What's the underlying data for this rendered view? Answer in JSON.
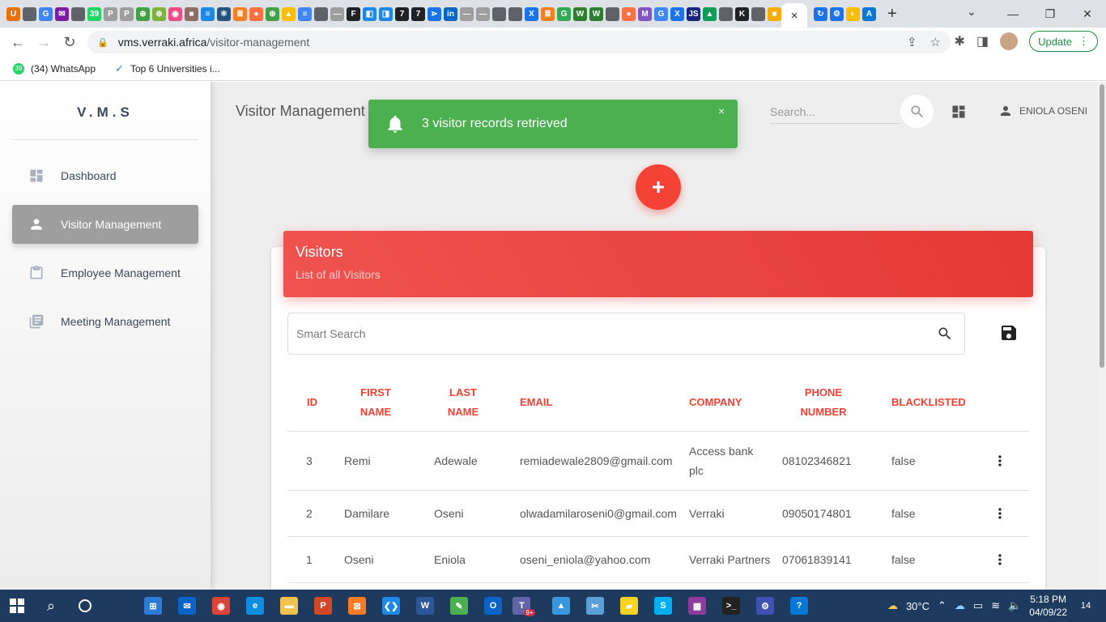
{
  "browser": {
    "active_tab_close": "×",
    "url_host": "vms.verraki.africa",
    "url_path": "/visitor-management",
    "update_label": "Update",
    "bookmarks": [
      {
        "label": "(34) WhatsApp",
        "badge": "39"
      },
      {
        "label": "Top 6 Universities i..."
      }
    ],
    "tab_favicons": [
      {
        "icon": "ublock-icon",
        "color": "#e8710a",
        "glyph": "U"
      },
      {
        "icon": "globe-icon",
        "color": "#5f6368",
        "glyph": ""
      },
      {
        "icon": "google-icon",
        "color": "#4285f4",
        "glyph": "G"
      },
      {
        "icon": "mail-icon",
        "color": "#7b1fa2",
        "glyph": "✉"
      },
      {
        "icon": "globe-icon",
        "color": "#5f6368",
        "glyph": ""
      },
      {
        "icon": "whatsapp-icon",
        "color": "#25d366",
        "glyph": "39"
      },
      {
        "icon": "p-icon",
        "color": "#9e9e9e",
        "glyph": "P"
      },
      {
        "icon": "p-icon",
        "color": "#9e9e9e",
        "glyph": "P"
      },
      {
        "icon": "eth-icon",
        "color": "#43a047",
        "glyph": "⊕"
      },
      {
        "icon": "eth-icon",
        "color": "#7cb342",
        "glyph": "⊕"
      },
      {
        "icon": "dribbble-icon",
        "color": "#ea4c89",
        "glyph": "◉"
      },
      {
        "icon": "square-icon",
        "color": "#8d6e63",
        "glyph": "■"
      },
      {
        "icon": "docs-icon",
        "color": "#1e88e5",
        "glyph": "≡"
      },
      {
        "icon": "react-icon",
        "color": "#26547c",
        "glyph": "⚛"
      },
      {
        "icon": "stack-icon",
        "color": "#f48024",
        "glyph": "≣"
      },
      {
        "icon": "fox-icon",
        "color": "#ff7043",
        "glyph": "●"
      },
      {
        "icon": "eth-icon",
        "color": "#43a047",
        "glyph": "⊕"
      },
      {
        "icon": "drive-icon",
        "color": "#fbbc04",
        "glyph": "▲"
      },
      {
        "icon": "docs-icon",
        "color": "#4285f4",
        "glyph": "≡"
      },
      {
        "icon": "globe-icon",
        "color": "#5f6368",
        "glyph": ""
      },
      {
        "icon": "line-icon",
        "color": "#9e9e9e",
        "glyph": "—"
      },
      {
        "icon": "f-icon",
        "color": "#202124",
        "glyph": "F"
      },
      {
        "icon": "chat-icon",
        "color": "#1e88e5",
        "glyph": "◧"
      },
      {
        "icon": "chat-icon",
        "color": "#1e88e5",
        "glyph": "◨"
      },
      {
        "icon": "seven-icon",
        "color": "#202124",
        "glyph": "7"
      },
      {
        "icon": "seven-icon",
        "color": "#202124",
        "glyph": "7"
      },
      {
        "icon": "share-icon",
        "color": "#1a73e8",
        "glyph": "⋗"
      },
      {
        "icon": "linkedin-icon",
        "color": "#0a66c2",
        "glyph": "in"
      },
      {
        "icon": "line-icon",
        "color": "#9e9e9e",
        "glyph": "—"
      },
      {
        "icon": "line-icon",
        "color": "#9e9e9e",
        "glyph": "—"
      },
      {
        "icon": "globe-icon",
        "color": "#5f6368",
        "glyph": ""
      },
      {
        "icon": "globe-icon",
        "color": "#5f6368",
        "glyph": ""
      },
      {
        "icon": "x-icon",
        "color": "#1a73e8",
        "glyph": "X"
      },
      {
        "icon": "stack-icon",
        "color": "#f48024",
        "glyph": "≣"
      },
      {
        "icon": "google-icon",
        "color": "#34a853",
        "glyph": "G"
      },
      {
        "icon": "w-icon",
        "color": "#2e7d32",
        "glyph": "W"
      },
      {
        "icon": "w-icon",
        "color": "#2e7d32",
        "glyph": "W"
      },
      {
        "icon": "globe-icon",
        "color": "#5f6368",
        "glyph": ""
      },
      {
        "icon": "fox-icon",
        "color": "#ff7043",
        "glyph": "●"
      },
      {
        "icon": "m-icon",
        "color": "#7e57c2",
        "glyph": "M"
      },
      {
        "icon": "google-icon",
        "color": "#4285f4",
        "glyph": "G"
      },
      {
        "icon": "x-icon",
        "color": "#1a73e8",
        "glyph": "X"
      },
      {
        "icon": "js-icon",
        "color": "#1a237e",
        "glyph": "JS"
      },
      {
        "icon": "drive-icon",
        "color": "#0f9d58",
        "glyph": "▲"
      },
      {
        "icon": "globe-icon",
        "color": "#5f6368",
        "glyph": ""
      },
      {
        "icon": "k-icon",
        "color": "#202124",
        "glyph": "K"
      },
      {
        "icon": "globe-icon",
        "color": "#5f6368",
        "glyph": ""
      },
      {
        "icon": "box-icon",
        "color": "#f9ab00",
        "glyph": "■"
      }
    ],
    "tab_favicons_after": [
      {
        "icon": "sync-icon",
        "color": "#1a73e8",
        "glyph": "↻"
      },
      {
        "icon": "gear-icon",
        "color": "#1a73e8",
        "glyph": "⚙"
      },
      {
        "icon": "circle-icon",
        "color": "#fbbc04",
        "glyph": "◐"
      },
      {
        "icon": "azure-icon",
        "color": "#0078d4",
        "glyph": "A"
      }
    ]
  },
  "app": {
    "logo": "V.M.S",
    "sidebar": {
      "items": [
        {
          "label": "Dashboard",
          "icon": "dashboard-icon",
          "active": false
        },
        {
          "label": "Visitor Management",
          "icon": "person-icon",
          "active": true
        },
        {
          "label": "Employee Management",
          "icon": "clipboard-icon",
          "active": false
        },
        {
          "label": "Meeting Management",
          "icon": "library-books-icon",
          "active": false
        }
      ]
    },
    "header": {
      "title": "Visitor Management",
      "search_placeholder": "Search...",
      "user_name": "ENIOLA OSENI"
    },
    "toast": {
      "message": "3 visitor records retrieved",
      "close": "×",
      "color": "#4caf50"
    },
    "fab_label": "+",
    "card": {
      "title": "Visitors",
      "subtitle": "List of all Visitors",
      "search_placeholder": "Smart Search",
      "accent": "#f44336",
      "columns": [
        "ID",
        "FIRST NAME",
        "LAST NAME",
        "EMAIL",
        "COMPANY",
        "PHONE NUMBER",
        "BLACKLISTED"
      ],
      "rows": [
        {
          "id": "3",
          "first": "Remi",
          "last": "Adewale",
          "email": "remiadewale2809@gmail.com",
          "company": "Access bank plc",
          "phone": "08102346821",
          "blacklisted": "false"
        },
        {
          "id": "2",
          "first": "Damilare",
          "last": "Oseni",
          "email": "olwadamilaroseni0@gmail.com",
          "company": "Verraki",
          "phone": "09050174801",
          "blacklisted": "false"
        },
        {
          "id": "1",
          "first": "Oseni",
          "last": "Eniola",
          "email": "oseni_eniola@yahoo.com",
          "company": "Verraki Partners",
          "phone": "07061839141",
          "blacklisted": "false"
        }
      ]
    }
  },
  "taskbar": {
    "apps": [
      {
        "icon": "task-view-icon",
        "color": "#1e3a5f",
        "glyph": ""
      },
      {
        "icon": "store-icon",
        "color": "#2d7bd6",
        "glyph": "⊞"
      },
      {
        "icon": "mail-icon",
        "color": "#0a64c8",
        "glyph": "✉"
      },
      {
        "icon": "chrome-icon",
        "color": "#db4437",
        "glyph": "◉"
      },
      {
        "icon": "edge-icon",
        "color": "#0c8ee0",
        "glyph": "e"
      },
      {
        "icon": "folder-icon",
        "color": "#f2c14e",
        "glyph": "▬"
      },
      {
        "icon": "powerpoint-icon",
        "color": "#d24726",
        "glyph": "P"
      },
      {
        "icon": "xampp-icon",
        "color": "#fb7a24",
        "glyph": "⊠"
      },
      {
        "icon": "vscode-icon",
        "color": "#1e88e5",
        "glyph": "❮❯"
      },
      {
        "icon": "word-icon",
        "color": "#2b579a",
        "glyph": "W"
      },
      {
        "icon": "notepad-icon",
        "color": "#4caf50",
        "glyph": "✎"
      },
      {
        "icon": "outlook-icon",
        "color": "#0a64c8",
        "glyph": "O"
      },
      {
        "icon": "teams-icon",
        "color": "#6264a7",
        "glyph": "T"
      },
      {
        "icon": "photos-icon",
        "color": "#3a96dd",
        "glyph": "▲"
      },
      {
        "icon": "snip-icon",
        "color": "#5c9fd6",
        "glyph": "✂"
      },
      {
        "icon": "sticky-notes-icon",
        "color": "#f7d21e",
        "glyph": "▰"
      },
      {
        "icon": "skype-icon",
        "color": "#00aff0",
        "glyph": "S"
      },
      {
        "icon": "winrar-icon",
        "color": "#8e3b9c",
        "glyph": "▦"
      },
      {
        "icon": "terminal-icon",
        "color": "#222222",
        "glyph": ">_"
      },
      {
        "icon": "network-tool-icon",
        "color": "#3f51b5",
        "glyph": "⚙"
      },
      {
        "icon": "help-icon",
        "color": "#0078d4",
        "glyph": "?"
      }
    ],
    "teams_badge": "9+",
    "temperature": "30°C",
    "time": "5:18 PM",
    "date": "04/09/22",
    "notifications": "14"
  }
}
